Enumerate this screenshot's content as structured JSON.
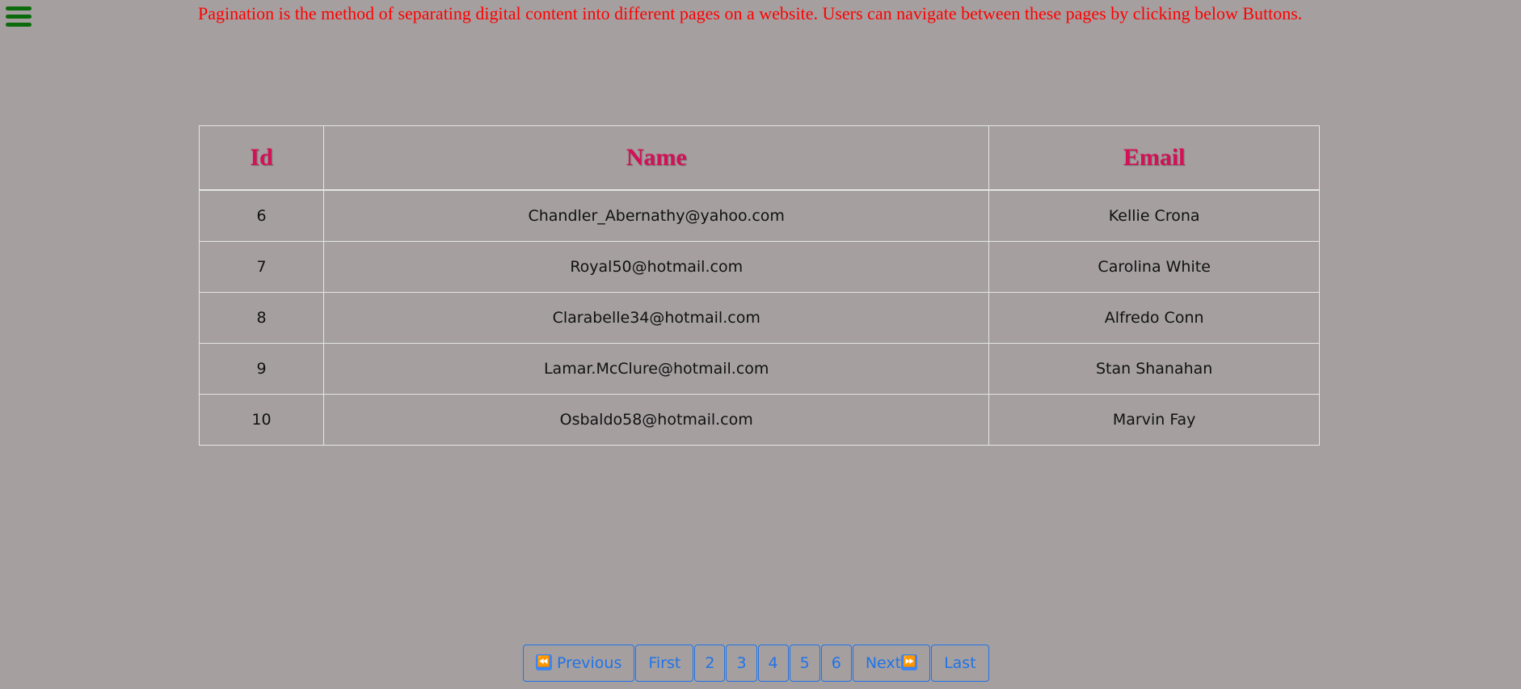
{
  "menu": {
    "icon": "hamburger-menu-icon",
    "color": "#0b6a0b"
  },
  "intro_text": "Pagination is the method of separating digital content into different pages on a website. Users can navigate between these pages by clicking below Buttons.",
  "table": {
    "headers": {
      "id": "Id",
      "name": "Name",
      "email": "Email"
    },
    "rows": [
      {
        "id": "6",
        "name": "Chandler_Abernathy@yahoo.com",
        "email": "Kellie Crona"
      },
      {
        "id": "7",
        "name": "Royal50@hotmail.com",
        "email": "Carolina White"
      },
      {
        "id": "8",
        "name": "Clarabelle34@hotmail.com",
        "email": "Alfredo Conn"
      },
      {
        "id": "9",
        "name": "Lamar.McClure@hotmail.com",
        "email": "Stan Shanahan"
      },
      {
        "id": "10",
        "name": "Osbaldo58@hotmail.com",
        "email": "Marvin Fay"
      }
    ]
  },
  "pagination": {
    "previous_icon": "⏪",
    "previous_label": "Previous",
    "first_label": "First",
    "pages": [
      "2",
      "3",
      "4",
      "5",
      "6"
    ],
    "next_label": "Next",
    "next_icon": "⏩",
    "last_label": "Last"
  },
  "colors": {
    "background": "#a59fa0",
    "intro_text": "#ff0000",
    "header_text": "#d41056",
    "accent": "#1f74e8"
  }
}
